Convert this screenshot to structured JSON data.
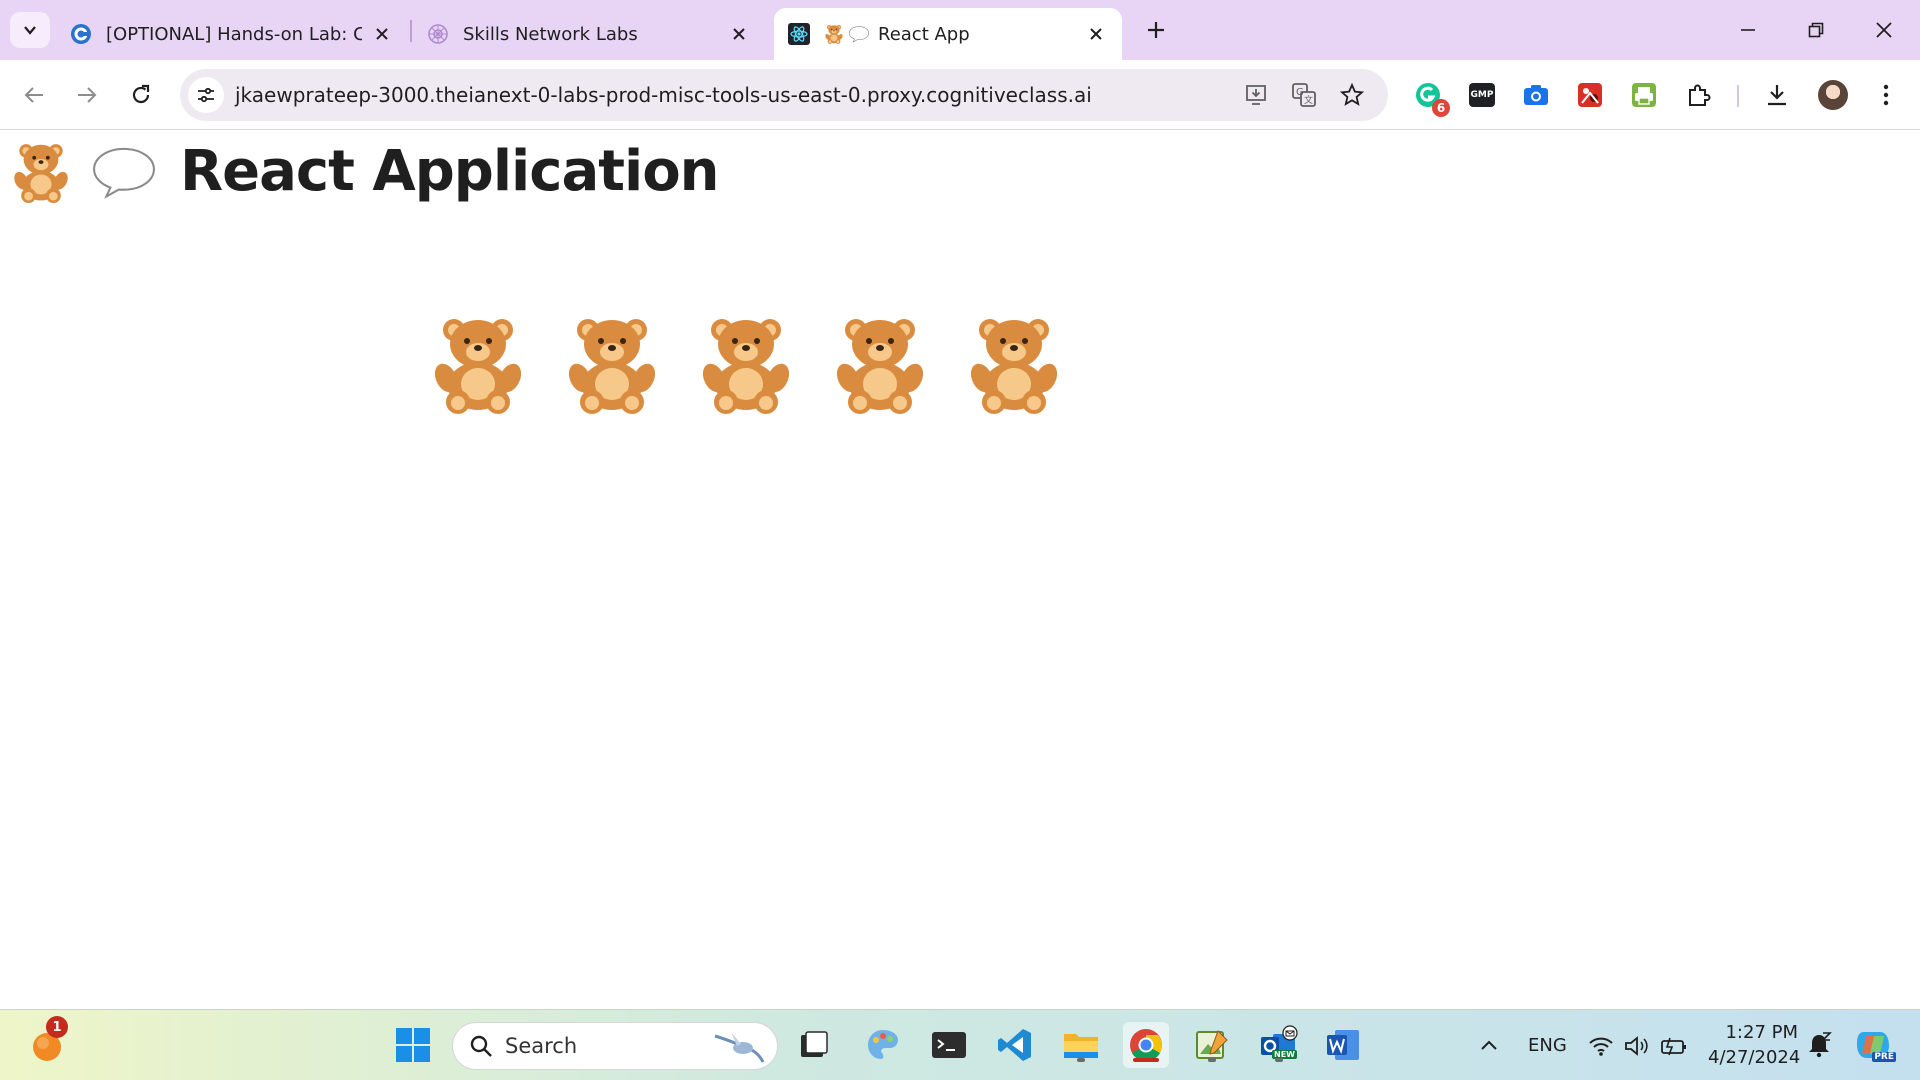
{
  "browser": {
    "tabs": [
      {
        "title": "[OPTIONAL] Hands-on Lab: Cre",
        "active": false
      },
      {
        "title": "Skills Network Labs",
        "active": false
      },
      {
        "title": "React App",
        "active": true
      }
    ],
    "address_url": "jkaewprateep-3000.theianext-0-labs-prod-misc-tools-us-east-0.proxy.cognitiveclass.ai",
    "extensions_badge_count": "6",
    "extension_gmp_label": "GMP"
  },
  "page": {
    "title": "React Application",
    "bear_count": 5,
    "icons": [
      "teddy-bear-icon",
      "speech-bubble-icon"
    ]
  },
  "taskbar": {
    "search_placeholder": "Search",
    "notification_badge": "1",
    "language": "ENG",
    "time": "1:27 PM",
    "date": "4/27/2024",
    "outlook_badge": "NEW",
    "copilot_badge": "PRE"
  },
  "colors": {
    "tabstrip_bg": "#e8d5f5",
    "omnibox_bg": "#efeaf2",
    "bear_main": "#d98c3f",
    "bear_light": "#f6c98a",
    "chrome_red": "#c42b1c"
  }
}
